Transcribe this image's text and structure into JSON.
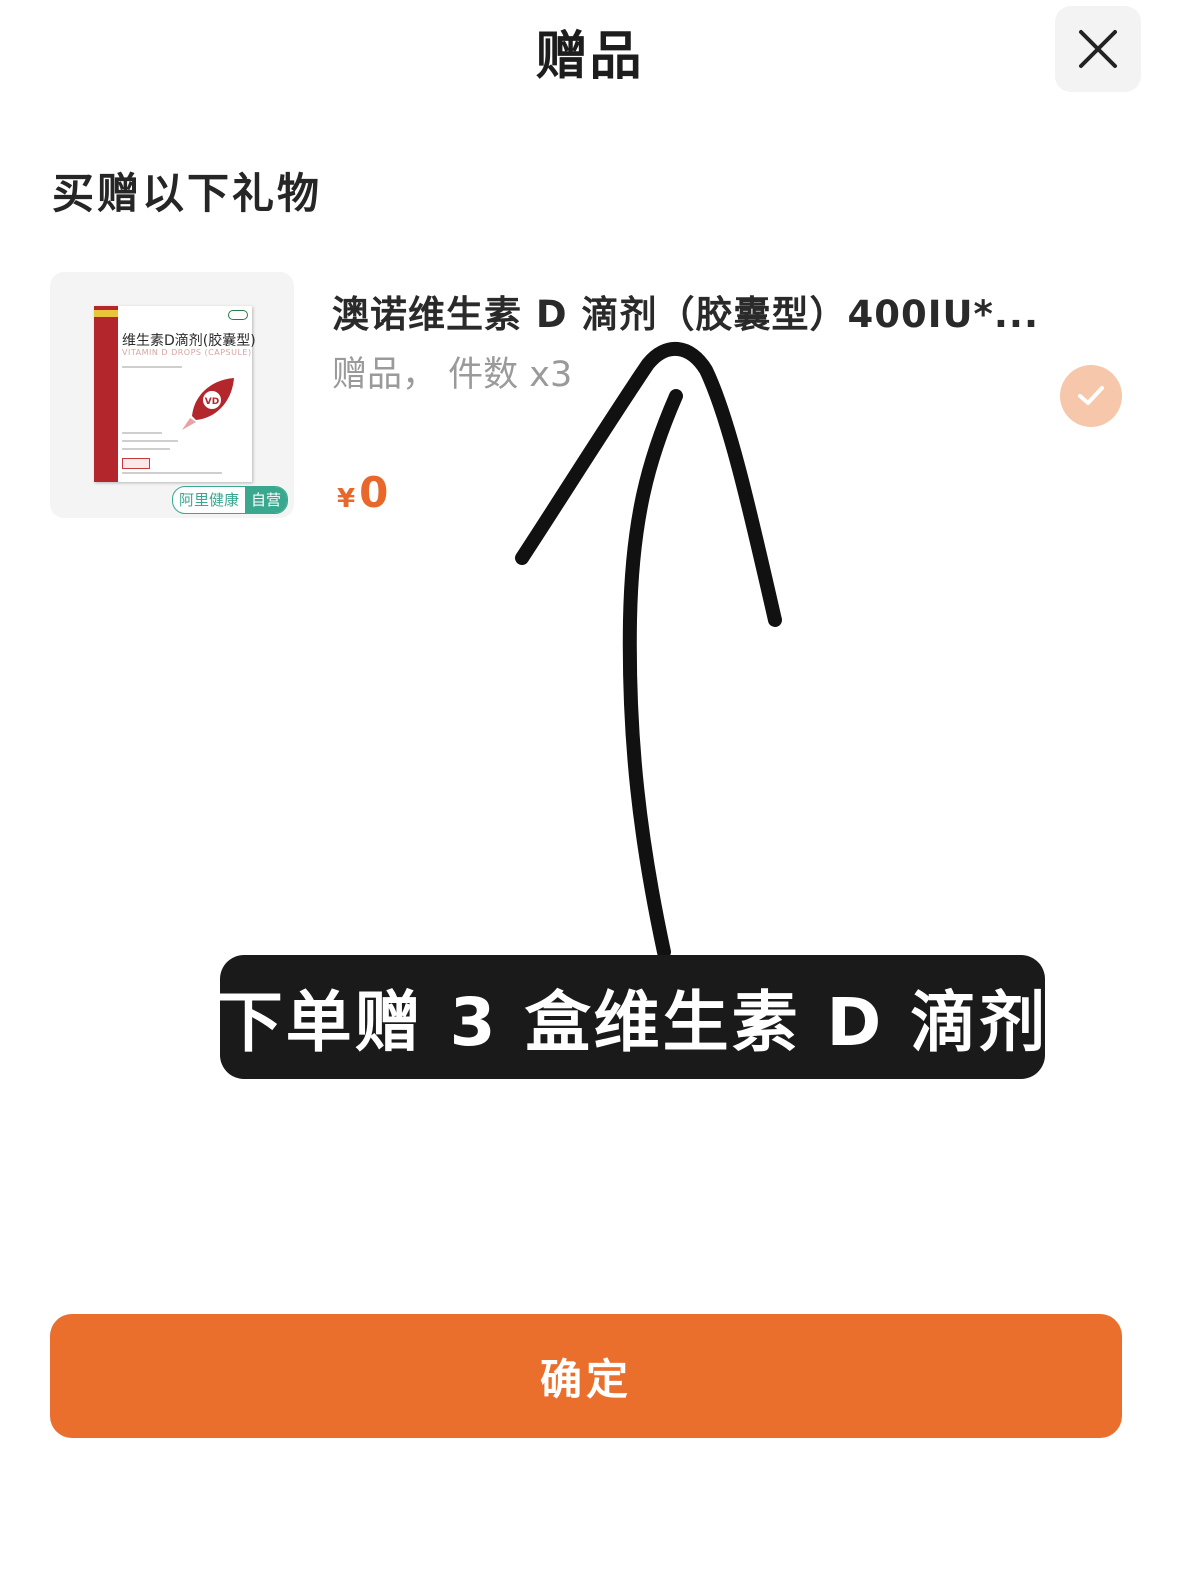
{
  "header": {
    "title": "赠品",
    "close_icon": "close-icon"
  },
  "section": {
    "title": "买赠以下礼物"
  },
  "gift_item": {
    "title": "澳诺维生素 D 滴剂（胶囊型）400IU*...",
    "meta": "赠品，  件数 x3",
    "price_symbol": "¥",
    "price_value": "0",
    "selected": true,
    "image": {
      "box_name": "维生素D滴剂(胶囊型)",
      "box_sub": "VITAMIN D DROPS (CAPSULE)",
      "badge_left": "阿里健康",
      "badge_right": "自营"
    }
  },
  "annotation": {
    "caption": "下单赠 3 盒维生素 D 滴剂"
  },
  "footer": {
    "confirm_label": "确定"
  },
  "colors": {
    "accent": "#ea6f2d",
    "price": "#e8672b",
    "check_bg": "#f6c7aa",
    "badge": "#39a88f",
    "caption_bg": "#1a1a1a"
  }
}
